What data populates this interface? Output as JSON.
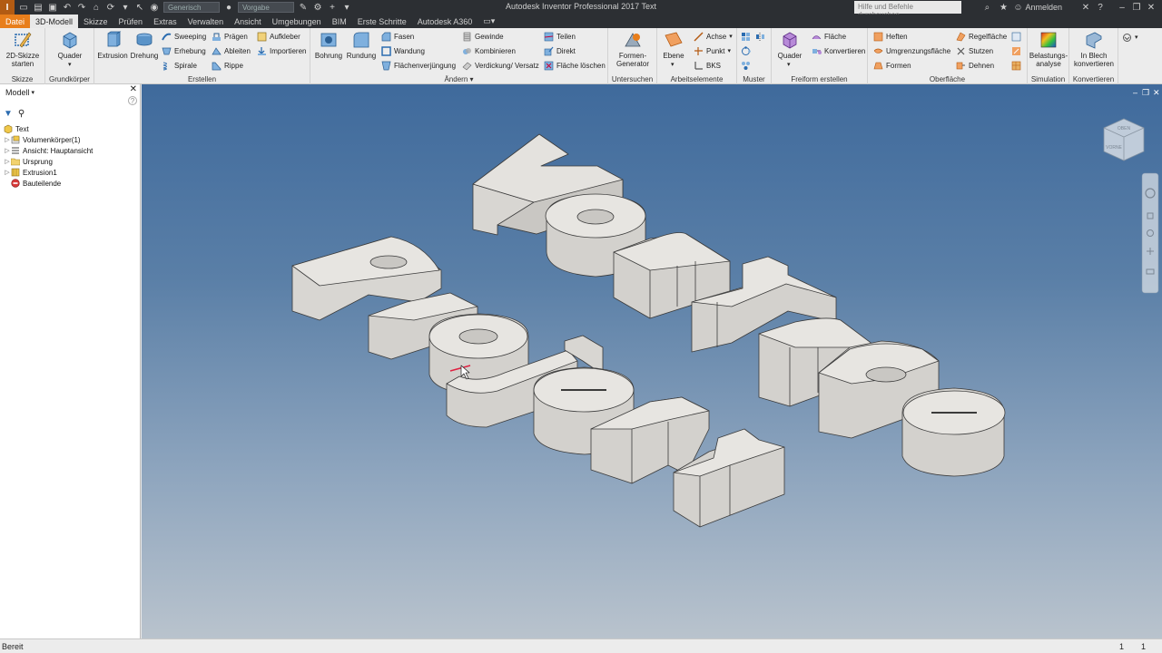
{
  "window": {
    "title": "Autodesk Inventor Professional 2017   Text",
    "help_placeholder": "Hilfe und Befehle durchsuchen...",
    "signin": "Anmelden"
  },
  "quick_access": {
    "material": "Generisch",
    "appearance": "Vorgabe"
  },
  "tabs": [
    "Datei",
    "3D-Modell",
    "Skizze",
    "Prüfen",
    "Extras",
    "Verwalten",
    "Ansicht",
    "Umgebungen",
    "BIM",
    "Erste Schritte",
    "Autodesk A360"
  ],
  "ribbon": {
    "skizze": {
      "label": "Skizze",
      "start_sketch": "2D-Skizze\nstarten"
    },
    "grundkoerper": {
      "label": "Grundkörper",
      "box": "Quader"
    },
    "erstellen": {
      "label": "Erstellen",
      "extrusion": "Extrusion",
      "drehung": "Drehung",
      "sweeping": "Sweeping",
      "erhebung": "Erhebung",
      "spirale": "Spirale",
      "praegen": "Prägen",
      "ableiten": "Ableiten",
      "rippe": "Rippe",
      "aufkleber": "Aufkleber",
      "importieren": "Importieren"
    },
    "aendern": {
      "label": "Ändern",
      "bohrung": "Bohrung",
      "rundung": "Rundung",
      "fasen": "Fasen",
      "wandung": "Wandung",
      "flaechenverjuengung": "Flächenverjüngung",
      "gewinde": "Gewinde",
      "kombinieren": "Kombinieren",
      "verdickung": "Verdickung/ Versatz",
      "teilen": "Teilen",
      "direkt": "Direkt",
      "flaeche_loeschen": "Fläche löschen"
    },
    "untersuchen": {
      "label": "Untersuchen",
      "formen_generator": "Formen-\nGenerator"
    },
    "arbeitselemente": {
      "label": "Arbeitselemente",
      "ebene": "Ebene",
      "achse": "Achse",
      "punkt": "Punkt",
      "bks": "BKS"
    },
    "muster": {
      "label": "Muster"
    },
    "freiform": {
      "label": "Freiform erstellen",
      "quader": "Quader",
      "flaeche": "Fläche",
      "konvertieren": "Konvertieren"
    },
    "oberflaeche": {
      "label": "Oberfläche",
      "heften": "Heften",
      "umgrenzungsflaeche": "Umgrenzungsfläche",
      "formen": "Formen",
      "regelflaeche": "Regelfläche",
      "stutzen": "Stutzen",
      "dehnen": "Dehnen"
    },
    "simulation": {
      "label": "Simulation",
      "belastungsanalyse": "Belastungs-\nanalyse"
    },
    "konvertieren": {
      "label": "Konvertieren",
      "in_blech": "In Blech\nkonvertieren"
    }
  },
  "browser": {
    "title": "Modell",
    "items": [
      {
        "label": "Text",
        "icon": "part-icon"
      },
      {
        "label": "Volumenkörper(1)",
        "icon": "solid-bodies-icon"
      },
      {
        "label": "Ansicht: Hauptansicht",
        "icon": "view-icon"
      },
      {
        "label": "Ursprung",
        "icon": "folder-icon"
      },
      {
        "label": "Extrusion1",
        "icon": "extrusion-icon"
      },
      {
        "label": "Bauteilende",
        "icon": "end-of-part-icon"
      }
    ]
  },
  "viewcube": {
    "front": "VORNE",
    "top": "OBEN"
  },
  "status": {
    "text": "Bereit",
    "count1": "1",
    "count2": "1"
  }
}
